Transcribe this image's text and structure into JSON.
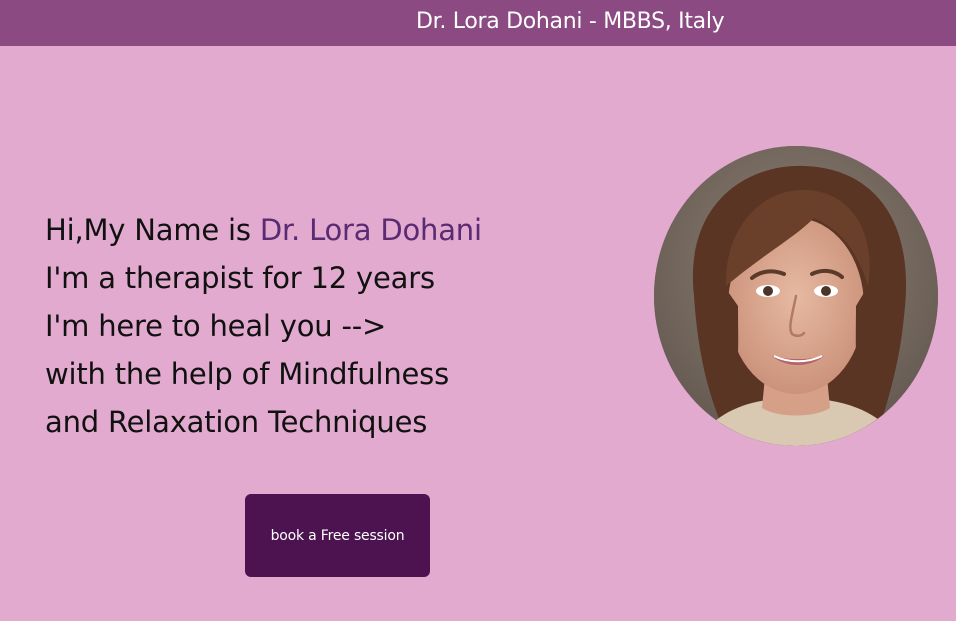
{
  "header": {
    "title": "Dr. Lora Dohani - MBBS, Italy"
  },
  "intro": {
    "greeting_prefix": "Hi,My Name is ",
    "name": "Dr. Lora Dohani",
    "line2": "I'm a therapist for 12 years",
    "line3": "I'm here to heal you -->",
    "line4": "with the help of Mindfulness",
    "line5": "and Relaxation Techniques"
  },
  "cta": {
    "label": "book a Free session"
  },
  "colors": {
    "background": "#e1aace",
    "header": "#8b4a82",
    "name_accent": "#5a2a72",
    "button": "#4d1350"
  },
  "avatar": {
    "description_icon": "portrait-photo"
  }
}
